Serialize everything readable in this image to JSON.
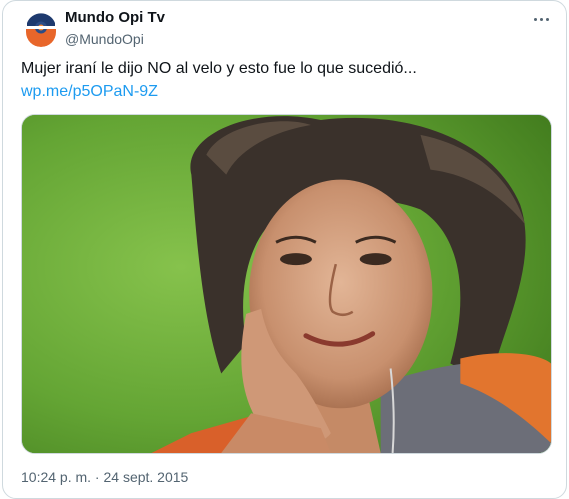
{
  "author": {
    "display_name": "Mundo Opi Tv",
    "handle": "@MundoOpi"
  },
  "tweet": {
    "text": "Mujer iraní le dijo NO al velo y esto fue lo que sucedió...",
    "link": "wp.me/p5OPaN-9Z",
    "timestamp": "10:24 p. m. · 24 sept. 2015"
  },
  "icons": {
    "more": "more-horizontal-icon",
    "avatar_logo": "mundo-opi-logo"
  },
  "colors": {
    "link": "#1d9bf0",
    "secondary_text": "#536471",
    "border": "#cfd9de"
  }
}
